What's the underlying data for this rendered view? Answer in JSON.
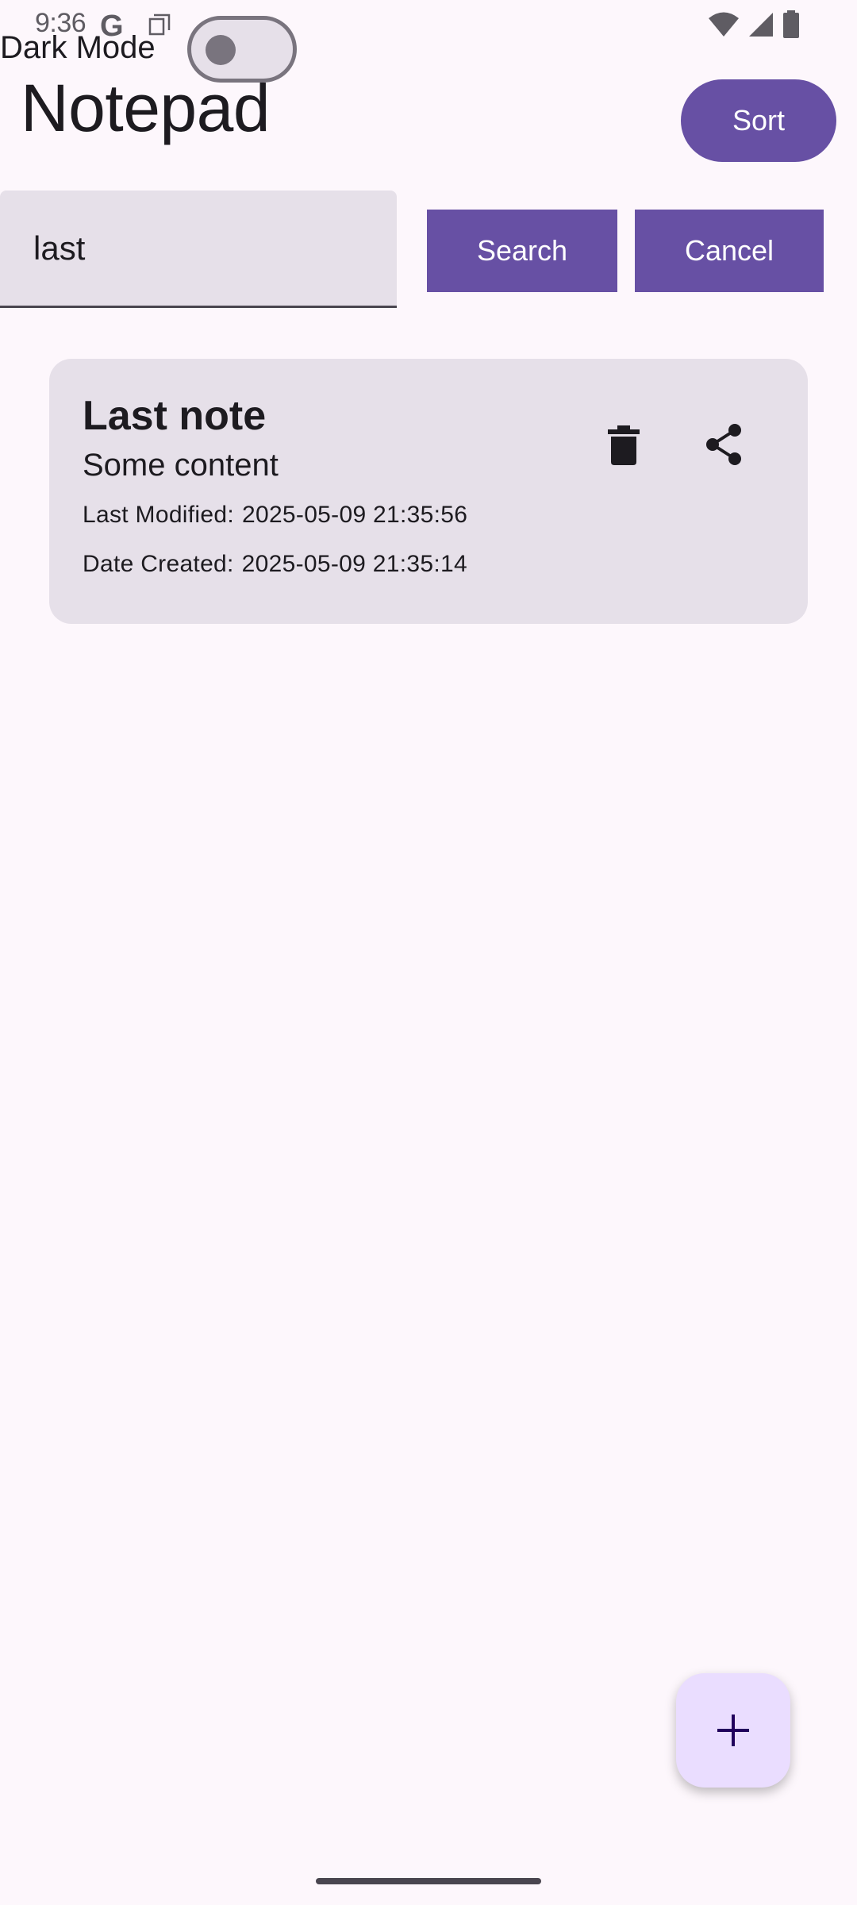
{
  "status_bar": {
    "time": "9:36",
    "google_glyph": "G",
    "icons": [
      "google-icon",
      "notification-icon",
      "wifi-icon",
      "signal-icon",
      "battery-icon"
    ]
  },
  "dark_mode": {
    "label": "Dark Mode",
    "enabled": false
  },
  "header": {
    "title": "Notepad",
    "sort_label": "Sort"
  },
  "search": {
    "value": "last",
    "search_label": "Search",
    "cancel_label": "Cancel"
  },
  "notes": [
    {
      "title": "Last note",
      "content": "Some content",
      "modified_label": "Last Modified:",
      "modified": "2025-05-09 21:35:56",
      "created_label": "Date Created:",
      "created": "2025-05-09 21:35:14",
      "icons": [
        "delete-icon",
        "share-icon"
      ]
    }
  ],
  "fab": {
    "icon": "plus-icon"
  },
  "colors": {
    "background": "#fdf7fc",
    "primary": "#6750a4",
    "surface_variant": "#e6e0e9",
    "fab": "#eaddff",
    "on_surface": "#1d1b20"
  }
}
